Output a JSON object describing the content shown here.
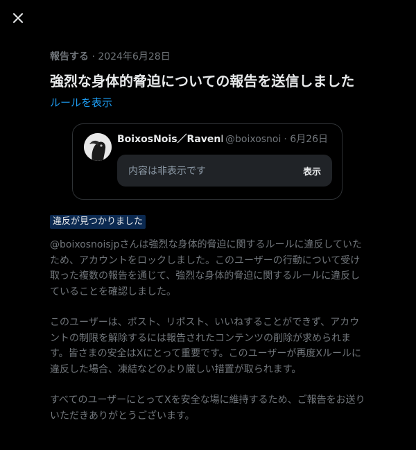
{
  "close_icon": "close-icon",
  "report": {
    "kind": "報告する",
    "separator": " · ",
    "date": "2024年6月28日",
    "title": "強烈な身体的脅迫についての報告を送信しました",
    "rules_link": "ルールを表示"
  },
  "tweet": {
    "avatar_icon": "avatar-image",
    "name": "BoixosNois／RavenFlock",
    "handle": "@boixosnoi",
    "date": "· 6月26日",
    "hidden_text": "内容は非表示です",
    "show_button": "表示"
  },
  "result": {
    "badge": "違反が見つかりました",
    "paragraph1": "@boixosnoisjpさんは強烈な身体的脅迫に関するルールに違反していたため、アカウントをロックしました。このユーザーの行動について受け取った複数の報告を通じて、強烈な身体的脅迫に関するルールに違反していることを確認しました。",
    "paragraph2": "このユーザーは、ポスト、リポスト、いいねすることができず、アカウントの制限を解除するには報告されたコンテンツの削除が求められます。皆さまの安全はXにとって重要です。このユーザーが再度Xルールに違反した場合、凍結などのより厳しい措置が取られます。",
    "paragraph3": "すべてのユーザーにとってXを安全な場に維持するため、ご報告をお送りいただきありがとうございます。"
  },
  "colors": {
    "background": "#000000",
    "text": "#e7e9ea",
    "muted": "#71767b",
    "link": "#1d9bf0",
    "badge_bg": "#0b2950"
  }
}
